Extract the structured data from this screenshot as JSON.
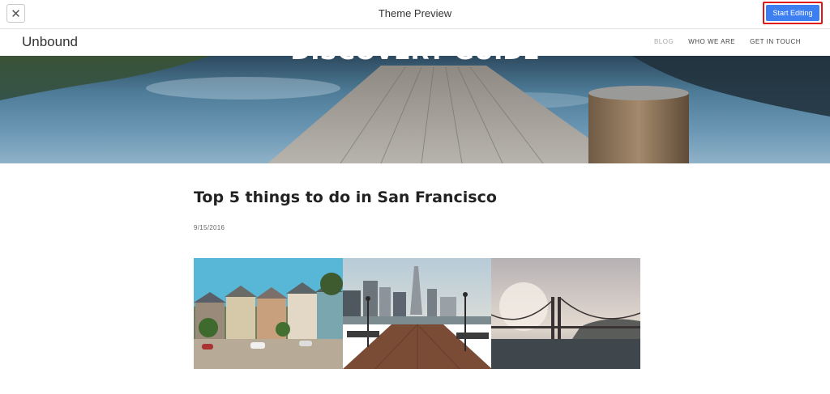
{
  "preview_bar": {
    "close_label": "✕",
    "title": "Theme Preview",
    "start_editing_label": "Start Editing",
    "accent_color": "#3d7ef0",
    "highlight_color": "#e01515"
  },
  "site": {
    "logo": "Unbound",
    "nav": [
      {
        "label": "BLOG",
        "active": true
      },
      {
        "label": "WHO WE ARE",
        "active": false
      },
      {
        "label": "GET IN TOUCH",
        "active": false
      }
    ],
    "banner_heading": "DISCOVERY GUIDE"
  },
  "article": {
    "title": "Top 5 things to do in San Francisco",
    "date": "9/15/2016",
    "gallery": [
      {
        "name": "painted-ladies-photo"
      },
      {
        "name": "pier-transamerica-photo"
      },
      {
        "name": "golden-gate-bridge-photo"
      }
    ]
  }
}
